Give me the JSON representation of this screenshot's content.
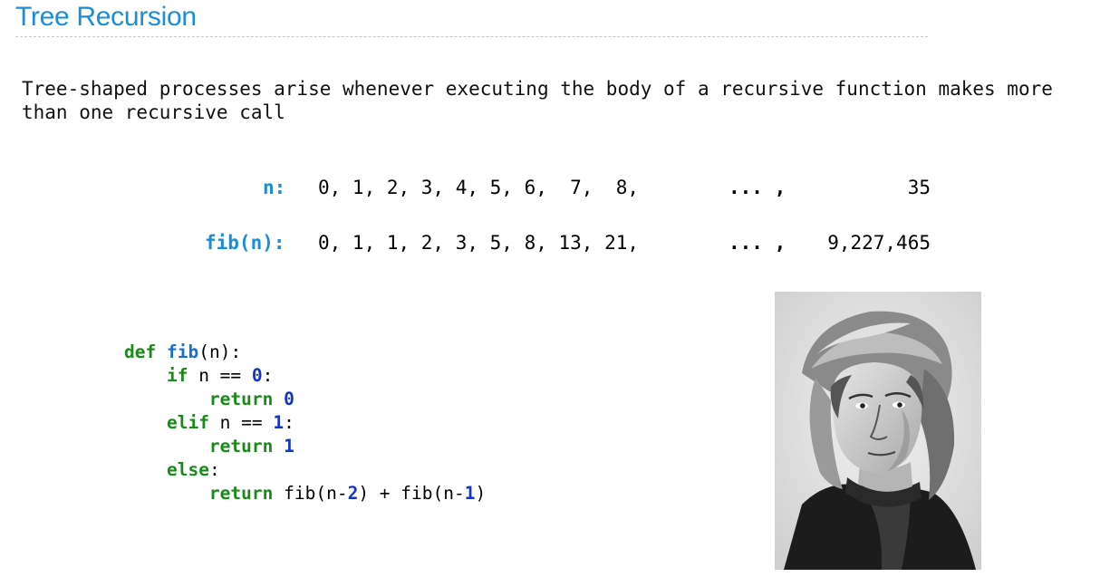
{
  "slide": {
    "title": "Tree Recursion",
    "intro_line1": "Tree-shaped processes arise whenever executing the body of a recursive function makes more",
    "intro_line2": "than one recursive call"
  },
  "sequence": {
    "n_label": "n:",
    "n_values": "0, 1, 2, 3, 4, 5, 6,  7,  8,",
    "n_ellipsis": "... ,",
    "n_last": "35",
    "fib_label": "fib(n):",
    "fib_values": "0, 1, 1, 2, 3, 5, 8, 13, 21,",
    "fib_ellipsis": "... ,",
    "fib_last": "9,227,465"
  },
  "code": {
    "def_kw": "def",
    "fn_name": "fib",
    "signature_rest": "(n):",
    "if_kw": "if",
    "if_cond": " n == ",
    "if_num": "0",
    "colon": ":",
    "return_kw": "return",
    "ret0": "0",
    "elif_kw": "elif",
    "elif_cond": " n == ",
    "elif_num": "1",
    "ret1": "1",
    "else_kw": "else",
    "rec_part1": " fib(n-",
    "rec_num1": "2",
    "rec_part2": ") + fib(n-",
    "rec_num2": "1",
    "rec_part3": ")"
  },
  "image": {
    "subject": "portrait-engraving"
  }
}
